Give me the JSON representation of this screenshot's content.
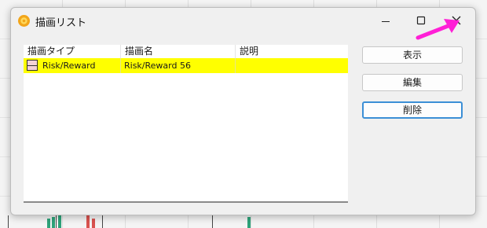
{
  "window": {
    "title": "描画リスト",
    "icon": "gear-app-icon"
  },
  "title_bar_buttons": [
    "minimize-icon",
    "maximize-icon",
    "close-icon"
  ],
  "list": {
    "columns": [
      "描画タイプ",
      "描画名",
      "説明"
    ],
    "rows": [
      {
        "type": "Risk/Reward",
        "name": "Risk/Reward 56",
        "description": "",
        "highlight": "#ffff00"
      }
    ]
  },
  "actions": {
    "show": "表示",
    "edit": "編集",
    "delete": "削除"
  },
  "colors": {
    "selection": "#ffff00",
    "focus_border": "#3c8fd6",
    "annotation_arrow": "#ff1fd6"
  }
}
